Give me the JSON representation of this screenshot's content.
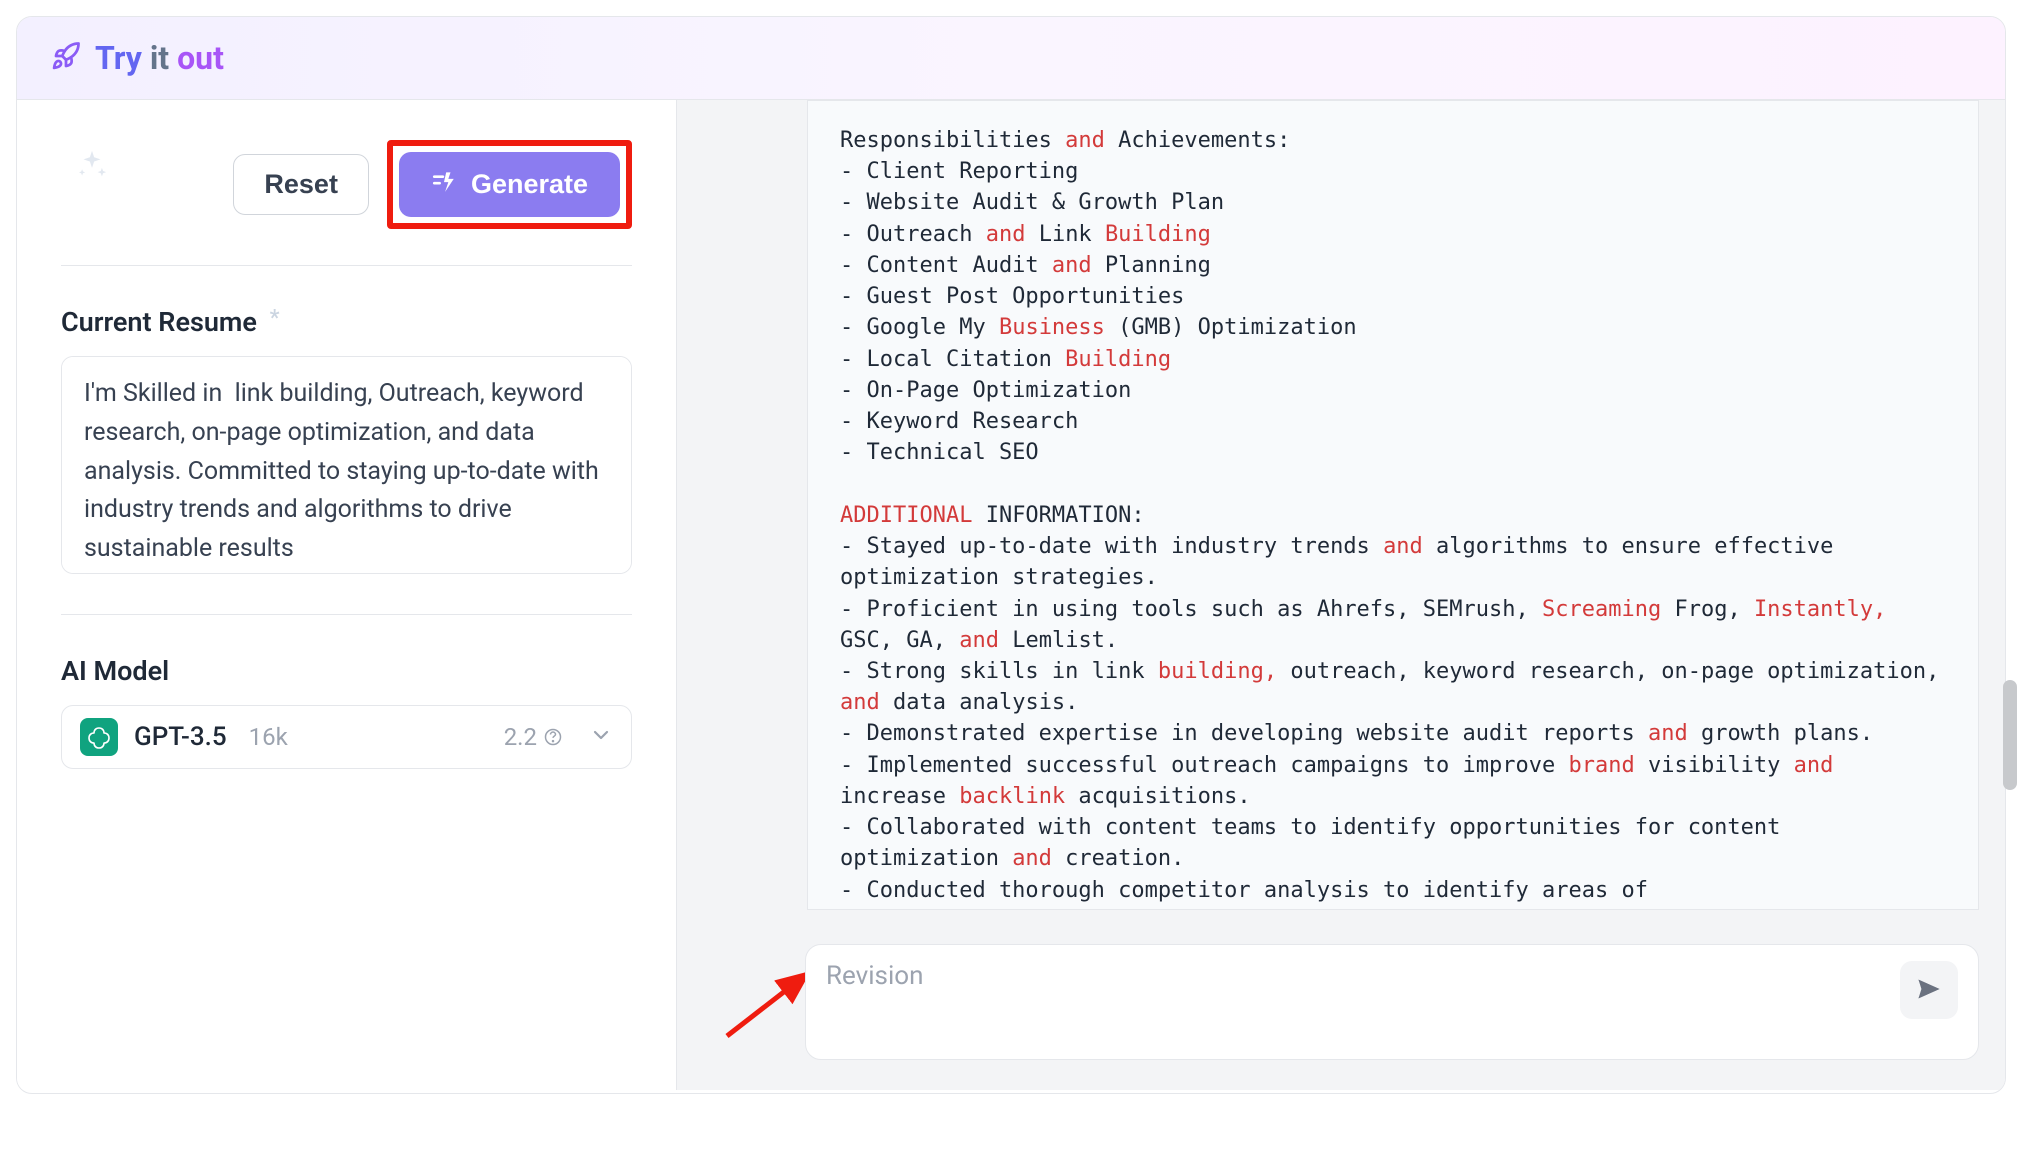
{
  "header": {
    "title_try": "Try",
    "title_it": "it",
    "title_out": "out"
  },
  "left": {
    "reset_label": "Reset",
    "generate_label": "Generate",
    "resume_label": "Current Resume",
    "resume_value": "I'm Skilled in  link building, Outreach, keyword research, on-page optimization, and data analysis. Committed to staying up-to-date with industry trends and algorithms to drive sustainable results",
    "ai_model_label": "AI Model",
    "model_name": "GPT-3.5",
    "model_ctx": "16k",
    "model_cost": "2.2"
  },
  "output": {
    "line01a": "Responsibilities ",
    "kw_and": "and",
    "line01b": " Achievements:",
    "bul1": "- Client Reporting",
    "bul2": "- Website Audit & Growth Plan",
    "bul3a": "- Outreach ",
    "bul3b": " Link ",
    "kw_building_cap": "Building",
    "bul4a": "- Content Audit ",
    "bul4b": " Planning",
    "bul5": "- Guest Post Opportunities",
    "bul6a": "- Google My ",
    "kw_business": "Business",
    "bul6b": " (GMB) Optimization",
    "bul7a": "- Local Citation ",
    "bul8": "- On-Page Optimization",
    "bul9": "- Keyword Research",
    "bul10": "- Technical SEO",
    "kw_additional": "ADDITIONAL",
    "add_info_b": " INFORMATION:",
    "ai1a": "- Stayed up-to-date with industry trends ",
    "ai1b": " algorithms to ensure effective optimization strategies.",
    "ai2a": "- Proficient in using tools such as Ahrefs, SEMrush, ",
    "kw_screaming": "Screaming",
    "ai2b": " Frog, ",
    "kw_instantly": "Instantly,",
    "ai2c": " GSC, GA, ",
    "ai2d": " Lemlist.",
    "ai3a": "- Strong skills in link ",
    "kw_building_lc": "building,",
    "ai3b": " outreach, keyword research, on-page optimization, ",
    "ai3c": " data analysis.",
    "ai4a": "- Demonstrated expertise in developing website audit reports ",
    "ai4b": " growth plans.",
    "ai5a": "- Implemented successful outreach campaigns to improve ",
    "kw_brand": "brand",
    "ai5b": " visibility ",
    "ai5c": " increase ",
    "kw_backlink": "backlink",
    "ai5d": " acquisitions.",
    "ai6a": "- Collaborated with content teams to identify opportunities for content optimization ",
    "ai6c": " creation.",
    "ai7": "- Conducted thorough competitor analysis to identify areas of"
  },
  "revision": {
    "placeholder": "Revision"
  }
}
